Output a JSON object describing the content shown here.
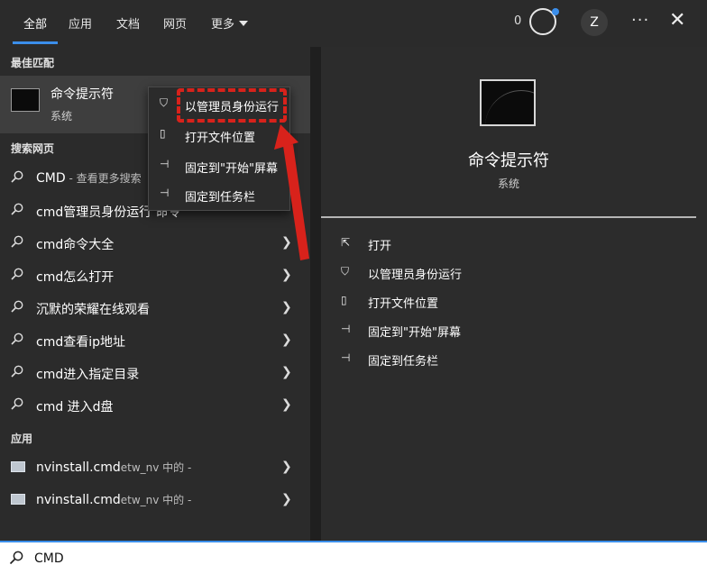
{
  "tabs": [
    "全部",
    "应用",
    "文档",
    "网页",
    "更多"
  ],
  "header": {
    "points": "0",
    "avatar": "Z",
    "more": "···",
    "close": "✕"
  },
  "sections": {
    "best_match": "最佳匹配",
    "web": "搜索网页",
    "apps": "应用"
  },
  "best_match": {
    "title": "命令提示符",
    "subtitle": "系统"
  },
  "web_results": [
    {
      "text": "CMD",
      "dim": " - 查看更多搜索"
    },
    {
      "text": "cmd管理员身份运行 命令",
      "dim": ""
    },
    {
      "text": "cmd命令大全",
      "dim": ""
    },
    {
      "text": "cmd怎么打开",
      "dim": ""
    },
    {
      "text": "沉默的荣耀在线观看",
      "dim": ""
    },
    {
      "text": "cmd查看ip地址",
      "dim": ""
    },
    {
      "text": "cmd进入指定目录",
      "dim": ""
    },
    {
      "text": "cmd 进入d盘",
      "dim": ""
    }
  ],
  "apps": [
    {
      "text": "nvinstall.cmd",
      "dim": "etw_nv 中的 -"
    },
    {
      "text": "nvinstall.cmd",
      "dim": "etw_nv 中的 -"
    }
  ],
  "context_menu": [
    "以管理员身份运行",
    "打开文件位置",
    "固定到\"开始\"屏幕",
    "固定到任务栏"
  ],
  "preview": {
    "title": "命令提示符",
    "subtitle": "系统",
    "actions": [
      "打开",
      "以管理员身份运行",
      "打开文件位置",
      "固定到\"开始\"屏幕",
      "固定到任务栏"
    ]
  },
  "search": {
    "value": "CMD"
  },
  "colors": {
    "accent": "#3b8eea",
    "annotation": "#d8221b"
  }
}
